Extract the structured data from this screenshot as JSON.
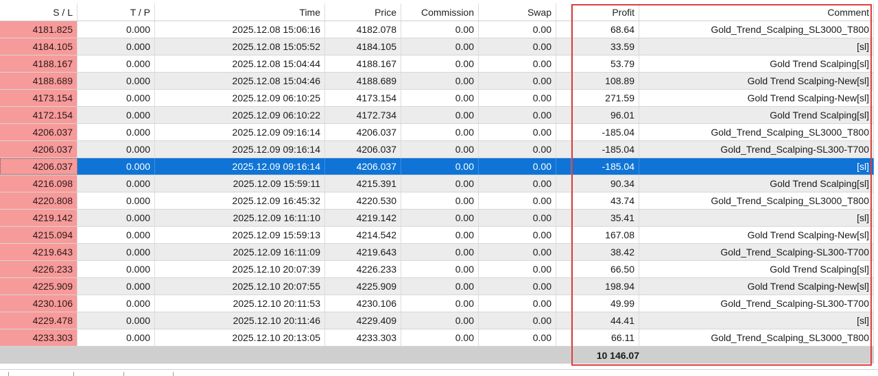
{
  "columns": {
    "sl": "S / L",
    "tp": "T / P",
    "time": "Time",
    "price": "Price",
    "commission": "Commission",
    "swap": "Swap",
    "profit": "Profit",
    "comment": "Comment"
  },
  "rows": [
    {
      "sl": "4181.825",
      "tp": "0.000",
      "time": "2025.12.08 15:06:16",
      "price": "4182.078",
      "commission": "0.00",
      "swap": "0.00",
      "profit": "68.64",
      "comment": "Gold_Trend_Scalping_SL3000_T800"
    },
    {
      "sl": "4184.105",
      "tp": "0.000",
      "time": "2025.12.08 15:05:52",
      "price": "4184.105",
      "commission": "0.00",
      "swap": "0.00",
      "profit": "33.59",
      "comment": "[sl]"
    },
    {
      "sl": "4188.167",
      "tp": "0.000",
      "time": "2025.12.08 15:04:44",
      "price": "4188.167",
      "commission": "0.00",
      "swap": "0.00",
      "profit": "53.79",
      "comment": "Gold Trend Scalping[sl]"
    },
    {
      "sl": "4188.689",
      "tp": "0.000",
      "time": "2025.12.08 15:04:46",
      "price": "4188.689",
      "commission": "0.00",
      "swap": "0.00",
      "profit": "108.89",
      "comment": "Gold Trend Scalping-New[sl]"
    },
    {
      "sl": "4173.154",
      "tp": "0.000",
      "time": "2025.12.09 06:10:25",
      "price": "4173.154",
      "commission": "0.00",
      "swap": "0.00",
      "profit": "271.59",
      "comment": "Gold Trend Scalping-New[sl]"
    },
    {
      "sl": "4172.154",
      "tp": "0.000",
      "time": "2025.12.09 06:10:22",
      "price": "4172.734",
      "commission": "0.00",
      "swap": "0.00",
      "profit": "96.01",
      "comment": "Gold Trend Scalping[sl]"
    },
    {
      "sl": "4206.037",
      "tp": "0.000",
      "time": "2025.12.09 09:16:14",
      "price": "4206.037",
      "commission": "0.00",
      "swap": "0.00",
      "profit": "-185.04",
      "comment": "Gold_Trend_Scalping_SL3000_T800"
    },
    {
      "sl": "4206.037",
      "tp": "0.000",
      "time": "2025.12.09 09:16:14",
      "price": "4206.037",
      "commission": "0.00",
      "swap": "0.00",
      "profit": "-185.04",
      "comment": "Gold_Trend_Scalping-SL300-T700"
    },
    {
      "sl": "4206.037",
      "tp": "0.000",
      "time": "2025.12.09 09:16:14",
      "price": "4206.037",
      "commission": "0.00",
      "swap": "0.00",
      "profit": "-185.04",
      "comment": "[sl]"
    },
    {
      "sl": "4216.098",
      "tp": "0.000",
      "time": "2025.12.09 15:59:11",
      "price": "4215.391",
      "commission": "0.00",
      "swap": "0.00",
      "profit": "90.34",
      "comment": "Gold Trend Scalping[sl]"
    },
    {
      "sl": "4220.808",
      "tp": "0.000",
      "time": "2025.12.09 16:45:32",
      "price": "4220.530",
      "commission": "0.00",
      "swap": "0.00",
      "profit": "43.74",
      "comment": "Gold_Trend_Scalping_SL3000_T800"
    },
    {
      "sl": "4219.142",
      "tp": "0.000",
      "time": "2025.12.09 16:11:10",
      "price": "4219.142",
      "commission": "0.00",
      "swap": "0.00",
      "profit": "35.41",
      "comment": "[sl]"
    },
    {
      "sl": "4215.094",
      "tp": "0.000",
      "time": "2025.12.09 15:59:13",
      "price": "4214.542",
      "commission": "0.00",
      "swap": "0.00",
      "profit": "167.08",
      "comment": "Gold Trend Scalping-New[sl]"
    },
    {
      "sl": "4219.643",
      "tp": "0.000",
      "time": "2025.12.09 16:11:09",
      "price": "4219.643",
      "commission": "0.00",
      "swap": "0.00",
      "profit": "38.42",
      "comment": "Gold_Trend_Scalping-SL300-T700"
    },
    {
      "sl": "4226.233",
      "tp": "0.000",
      "time": "2025.12.10 20:07:39",
      "price": "4226.233",
      "commission": "0.00",
      "swap": "0.00",
      "profit": "66.50",
      "comment": "Gold Trend Scalping[sl]"
    },
    {
      "sl": "4225.909",
      "tp": "0.000",
      "time": "2025.12.10 20:07:55",
      "price": "4225.909",
      "commission": "0.00",
      "swap": "0.00",
      "profit": "198.94",
      "comment": "Gold Trend Scalping-New[sl]"
    },
    {
      "sl": "4230.106",
      "tp": "0.000",
      "time": "2025.12.10 20:11:53",
      "price": "4230.106",
      "commission": "0.00",
      "swap": "0.00",
      "profit": "49.99",
      "comment": "Gold_Trend_Scalping-SL300-T700"
    },
    {
      "sl": "4229.478",
      "tp": "0.000",
      "time": "2025.12.10 20:11:46",
      "price": "4229.409",
      "commission": "0.00",
      "swap": "0.00",
      "profit": "44.41",
      "comment": "[sl]"
    },
    {
      "sl": "4233.303",
      "tp": "0.000",
      "time": "2025.12.10 20:13:05",
      "price": "4233.303",
      "commission": "0.00",
      "swap": "0.00",
      "profit": "66.11",
      "comment": "Gold_Trend_Scalping_SL3000_T800"
    }
  ],
  "selected_row": 8,
  "total_profit": "10 146.07",
  "colors": {
    "sl_highlight": "#f79a9a",
    "selection": "#0f74d6",
    "highlight_box": "#e23b3b",
    "alt_row": "#ececec",
    "total_bar": "#cfcfcf"
  }
}
